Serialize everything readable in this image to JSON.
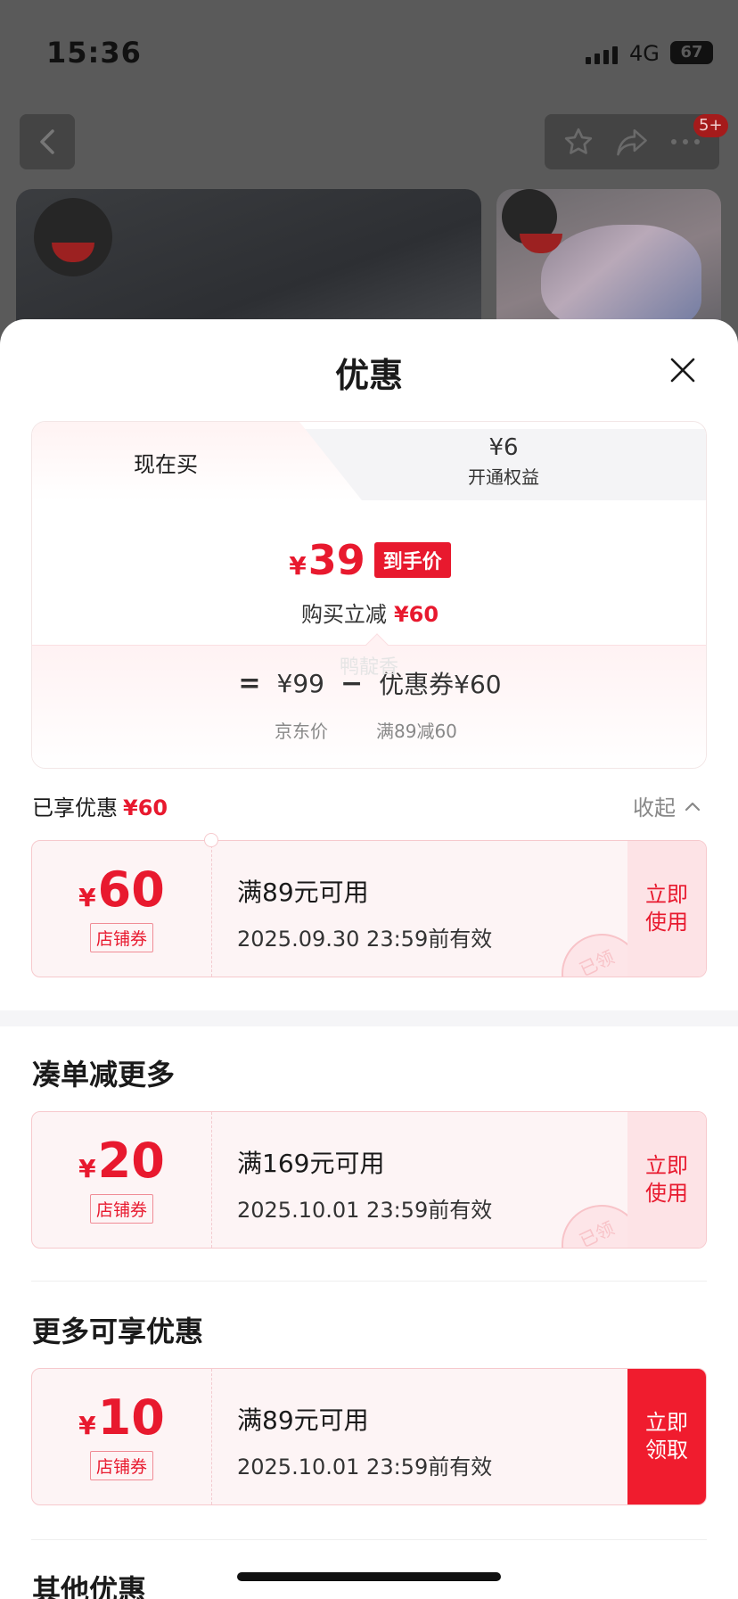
{
  "status_bar": {
    "time": "15:36",
    "network": "4G",
    "battery": "67"
  },
  "background": {
    "notification_badge": "5+"
  },
  "sheet": {
    "title": "优惠",
    "tabs": [
      {
        "label": "现在买"
      },
      {
        "price": "¥6",
        "label": "开通权益"
      }
    ],
    "final_price": {
      "currency": "¥",
      "value": "39",
      "tag": "到手价"
    },
    "instant": {
      "label": "购买立减",
      "amount": "¥60"
    },
    "calculation": {
      "equals": "=",
      "jd_price": "¥99",
      "minus": "−",
      "coupon": "优惠券¥60",
      "jd_price_label": "京东价",
      "coupon_label": "满89减60"
    },
    "watermark": "鸭靛香",
    "enjoyed": {
      "label": "已享优惠",
      "amount": "¥60",
      "collapse": "收起"
    },
    "sections": {
      "more_order": "凑单减更多",
      "more_offers": "更多可享优惠",
      "other": "其他优惠"
    },
    "coupons": [
      {
        "currency": "¥",
        "amount": "60",
        "type": "店铺券",
        "condition": "满89元可用",
        "expire": "2025.09.30 23:59前有效",
        "action": "立即使用",
        "stamp": "已领"
      },
      {
        "currency": "¥",
        "amount": "20",
        "type": "店铺券",
        "condition": "满169元可用",
        "expire": "2025.10.01 23:59前有效",
        "action": "立即使用",
        "stamp": "已领"
      },
      {
        "currency": "¥",
        "amount": "10",
        "type": "店铺券",
        "condition": "满89元可用",
        "expire": "2025.10.01 23:59前有效",
        "action": "立即领取"
      }
    ]
  }
}
